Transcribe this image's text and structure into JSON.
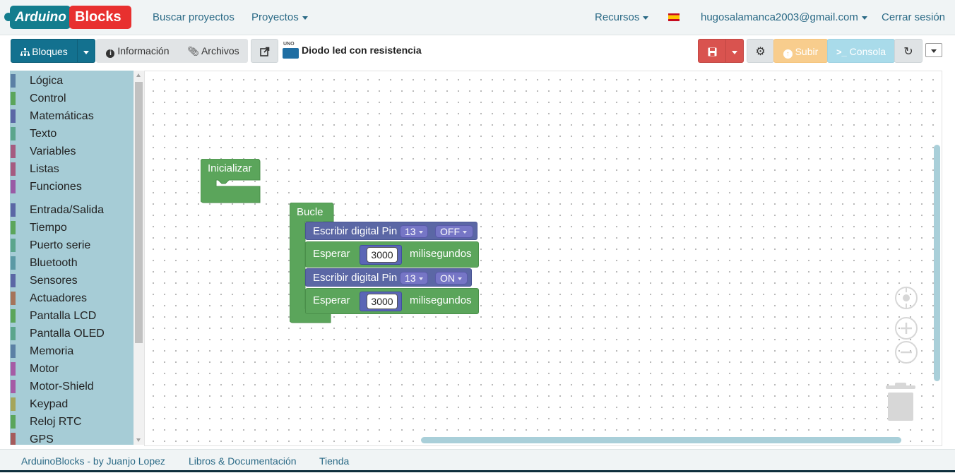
{
  "header": {
    "logo": {
      "part1": "Arduino",
      "part2": "Blocks"
    },
    "nav": {
      "search_projects": "Buscar proyectos",
      "projects": "Proyectos",
      "resources": "Recursos",
      "user_email": "hugosalamanca2003@gmail.com",
      "logout": "Cerrar sesión"
    }
  },
  "toolbar": {
    "blocks": "Bloques",
    "info": "Información",
    "files": "Archivos",
    "board_label": "UNO",
    "project_title": "Diodo led con resistencia",
    "upload": "Subir",
    "console": "Consola",
    "colors": {
      "primary": "#13718f",
      "danger": "#d9534f",
      "warning": "#f8cd8d",
      "info": "#a9dbea"
    }
  },
  "toolbox": {
    "items": [
      {
        "label": "Lógica",
        "color": "#5b80a5"
      },
      {
        "label": "Control",
        "color": "#5ba55b"
      },
      {
        "label": "Matemáticas",
        "color": "#5b67a5"
      },
      {
        "label": "Texto",
        "color": "#5ba58c"
      },
      {
        "label": "Variables",
        "color": "#a55b80"
      },
      {
        "label": "Listas",
        "color": "#a55b80"
      },
      {
        "label": "Funciones",
        "color": "#995ba5"
      },
      {
        "label": "Entrada/Salida",
        "color": "#5b67a5"
      },
      {
        "label": "Tiempo",
        "color": "#5ba55b"
      },
      {
        "label": "Puerto serie",
        "color": "#5ba58c"
      },
      {
        "label": "Bluetooth",
        "color": "#5b99a5"
      },
      {
        "label": "Sensores",
        "color": "#5b67a5"
      },
      {
        "label": "Actuadores",
        "color": "#a5745b"
      },
      {
        "label": "Pantalla LCD",
        "color": "#5ba55b"
      },
      {
        "label": "Pantalla OLED",
        "color": "#5ba58c"
      },
      {
        "label": "Memoria",
        "color": "#5b80a5"
      },
      {
        "label": "Motor",
        "color": "#a55ba5"
      },
      {
        "label": "Motor-Shield",
        "color": "#a55ba5"
      },
      {
        "label": "Keypad",
        "color": "#a5a55b"
      },
      {
        "label": "Reloj RTC",
        "color": "#5ba55b"
      },
      {
        "label": "GPS",
        "color": "#a55b5b"
      }
    ]
  },
  "workspace": {
    "init_block": {
      "label": "Inicializar"
    },
    "loop_block": {
      "label": "Bucle",
      "statements": [
        {
          "type": "digital_write",
          "label": "Escribir digital Pin",
          "pin": "13",
          "state": "OFF"
        },
        {
          "type": "delay",
          "label": "Esperar",
          "value": "3000",
          "unit": "milisegundos"
        },
        {
          "type": "digital_write",
          "label": "Escribir digital Pin",
          "pin": "13",
          "state": "ON"
        },
        {
          "type": "delay",
          "label": "Esperar",
          "value": "3000",
          "unit": "milisegundos"
        }
      ]
    },
    "colors": {
      "init_loop": "#5ba55b",
      "io": "#5b67a5",
      "time": "#5ba55b"
    }
  },
  "footer": {
    "credit": "ArduinoBlocks - by Juanjo Lopez",
    "docs": "Libros & Documentación",
    "shop": "Tienda"
  }
}
